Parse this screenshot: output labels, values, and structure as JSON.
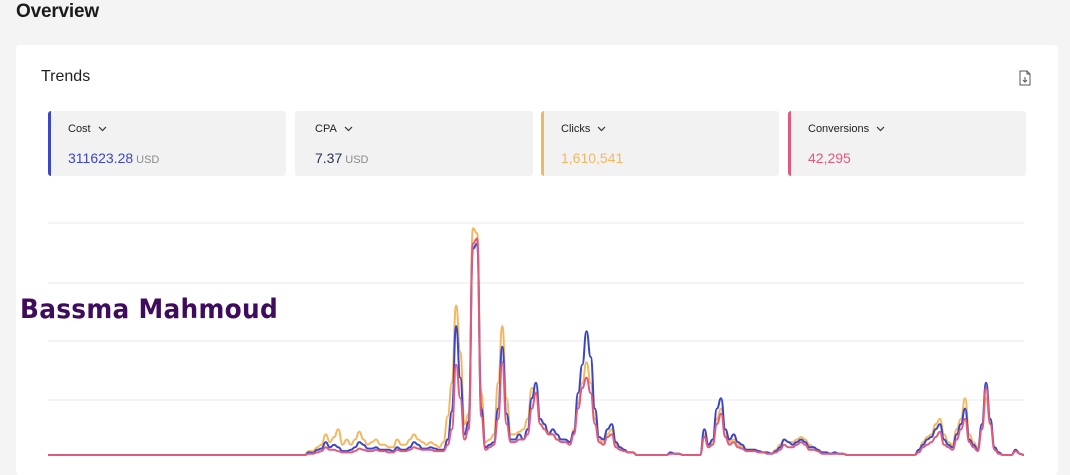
{
  "page": {
    "title": "Overview"
  },
  "card": {
    "title": "Trends",
    "export_icon": "file-export-icon"
  },
  "metrics": [
    {
      "label": "Cost",
      "value": "311623.28",
      "unit": "USD",
      "color": "#3b46c4",
      "value_color": "#3b46c4"
    },
    {
      "label": "CPA",
      "value": "7.37",
      "unit": "USD",
      "color": "",
      "value_color": "#2a3552"
    },
    {
      "label": "Clicks",
      "value": "1,610,541",
      "unit": "",
      "color": "#f2b861",
      "value_color": "#f2b861"
    },
    {
      "label": "Conversions",
      "value": "42,295",
      "unit": "",
      "color": "#e05a7e",
      "value_color": "#e05a7e"
    }
  ],
  "watermark": "Bassma Mahmoud",
  "chart_data": {
    "type": "line",
    "title": "",
    "grid": true,
    "series": [
      {
        "color": "#3b46c4",
        "values": [
          0,
          0,
          0,
          0,
          0,
          0,
          0,
          0,
          0,
          0,
          0,
          0,
          0,
          0,
          0,
          0,
          0,
          0,
          0,
          0,
          0,
          0,
          0,
          0,
          0,
          0,
          0,
          0,
          0,
          0,
          0,
          0,
          0,
          0,
          0,
          0,
          0,
          0,
          0,
          0,
          0,
          0,
          0,
          0,
          0,
          0,
          0,
          0,
          0,
          0,
          0,
          0,
          0,
          0,
          0,
          0,
          0,
          0,
          0,
          0,
          0,
          0,
          1.0,
          0.8,
          2,
          2.5,
          5,
          3,
          4,
          3,
          1.5,
          1.5,
          2,
          3,
          5,
          4,
          2.5,
          2.5,
          3,
          2,
          2,
          2,
          1.5,
          3,
          2,
          2,
          3,
          5,
          4,
          2.5,
          2.5,
          3,
          2.5,
          2,
          2,
          6,
          17,
          50,
          30,
          8,
          13,
          80,
          82,
          18,
          3,
          4,
          5,
          18,
          42,
          16,
          6,
          6,
          8,
          6,
          10,
          22,
          28,
          14,
          12,
          8,
          10,
          8,
          6,
          6,
          5,
          9,
          24,
          35,
          48,
          38,
          18,
          7,
          6,
          10,
          12,
          5,
          3,
          2,
          1,
          1,
          0,
          0,
          0,
          0,
          0,
          0,
          0,
          0,
          1,
          0.5,
          0.5,
          0,
          0,
          0,
          0,
          0,
          10,
          4,
          6,
          18,
          22,
          10,
          6,
          8,
          5,
          4,
          2,
          2,
          2,
          1.5,
          1,
          1,
          0.5,
          1.5,
          3,
          6,
          5,
          4,
          5,
          6,
          5,
          3,
          3,
          2,
          1,
          1,
          0.5,
          1,
          0.5,
          0.5,
          0,
          0,
          0,
          0,
          0,
          0,
          0,
          0,
          0,
          0,
          0,
          0,
          0,
          0,
          0,
          0,
          0,
          2,
          4,
          6,
          7,
          10,
          12,
          6,
          4,
          3,
          8,
          12,
          18,
          6,
          4,
          2,
          12,
          28,
          14,
          3,
          1,
          0,
          0,
          0,
          2,
          0.5,
          0
        ]
      },
      {
        "color": "#f2b861",
        "values": [
          0,
          0,
          0,
          0,
          0,
          0,
          0,
          0,
          0,
          0,
          0,
          0,
          0,
          0,
          0,
          0,
          0,
          0,
          0,
          0,
          0,
          0,
          0,
          0,
          0,
          0,
          0,
          0,
          0,
          0,
          0,
          0,
          0,
          0,
          0,
          0,
          0,
          0,
          0,
          0,
          0,
          0,
          0,
          0,
          0,
          0,
          0,
          0,
          0,
          0,
          0,
          0,
          0,
          0,
          0,
          0,
          0,
          0,
          0,
          0,
          0,
          0,
          1.5,
          1.5,
          3,
          4,
          8,
          5,
          7,
          10,
          4,
          6,
          4,
          6,
          9,
          6,
          4,
          5,
          6,
          4,
          4,
          3,
          3,
          6,
          4,
          4,
          6,
          8,
          6,
          5,
          4,
          5,
          4,
          3,
          5,
          15,
          28,
          58,
          40,
          12,
          16,
          88,
          86,
          24,
          5,
          6,
          8,
          28,
          50,
          22,
          8,
          8,
          9,
          10,
          14,
          26,
          24,
          12,
          10,
          9,
          8,
          6,
          6,
          6,
          4,
          10,
          20,
          28,
          36,
          28,
          14,
          6,
          5,
          8,
          10,
          4,
          2,
          1.5,
          1,
          1,
          0,
          0,
          0,
          0,
          0,
          0,
          0,
          0,
          1,
          0.5,
          0.5,
          0,
          0,
          0,
          0,
          0,
          8,
          3,
          5,
          14,
          18,
          8,
          5,
          6,
          4,
          3,
          2,
          2,
          2,
          1.5,
          1,
          1,
          0.5,
          2,
          4,
          6,
          5,
          5,
          6,
          7,
          6,
          4,
          3,
          2,
          1,
          1,
          0.5,
          1,
          0.5,
          0.5,
          0,
          0,
          0,
          0,
          0,
          0,
          0,
          0,
          0,
          0,
          0,
          0,
          0,
          0,
          0,
          0,
          0,
          2,
          5,
          7,
          8,
          12,
          14,
          8,
          5,
          4,
          10,
          14,
          22,
          8,
          5,
          3,
          10,
          22,
          12,
          3,
          1,
          0,
          0,
          0,
          2,
          0.5,
          0
        ]
      },
      {
        "color": "#e05a7e",
        "values": [
          0,
          0,
          0,
          0,
          0,
          0,
          0,
          0,
          0,
          0,
          0,
          0,
          0,
          0,
          0,
          0,
          0,
          0,
          0,
          0,
          0,
          0,
          0,
          0,
          0,
          0,
          0,
          0,
          0,
          0,
          0,
          0,
          0,
          0,
          0,
          0,
          0,
          0,
          0,
          0,
          0,
          0,
          0,
          0,
          0,
          0,
          0,
          0,
          0,
          0,
          0,
          0,
          0,
          0,
          0,
          0,
          0,
          0,
          0,
          0,
          0,
          0,
          0.5,
          0.5,
          1,
          1.5,
          3,
          2,
          2,
          1.5,
          1,
          1,
          1,
          1.5,
          2.5,
          2,
          1.5,
          1.5,
          2,
          1.5,
          1.5,
          1,
          1,
          2,
          1.5,
          1.5,
          2,
          3,
          2.5,
          2,
          2,
          2,
          1.5,
          1.5,
          1.5,
          4,
          10,
          35,
          22,
          6,
          10,
          82,
          84,
          15,
          2,
          3,
          4,
          14,
          36,
          12,
          5,
          5,
          6,
          6,
          8,
          18,
          24,
          12,
          10,
          8,
          8,
          6,
          5,
          5,
          4,
          8,
          18,
          26,
          30,
          24,
          12,
          5,
          4,
          7,
          8,
          3,
          2,
          1.5,
          1,
          1,
          0,
          0,
          0,
          0,
          0,
          0,
          0,
          0,
          0.5,
          0.5,
          0.5,
          0,
          0,
          0,
          0,
          0,
          7,
          3,
          4,
          12,
          16,
          7,
          4,
          5,
          3,
          2.5,
          1.5,
          1.5,
          1.5,
          1,
          1,
          0.5,
          0.5,
          1,
          2,
          4,
          3,
          3,
          4,
          5,
          4,
          2,
          2,
          1.5,
          0.5,
          0.5,
          0.5,
          0.5,
          0.5,
          0.5,
          0,
          0,
          0,
          0,
          0,
          0,
          0,
          0,
          0,
          0,
          0,
          0,
          0,
          0,
          0,
          0,
          0,
          1,
          3,
          4,
          5,
          7,
          9,
          4,
          3,
          2,
          6,
          10,
          14,
          5,
          3,
          1.5,
          10,
          26,
          12,
          2,
          0.5,
          0,
          0,
          0,
          1.5,
          0.5,
          0
        ]
      }
    ]
  }
}
